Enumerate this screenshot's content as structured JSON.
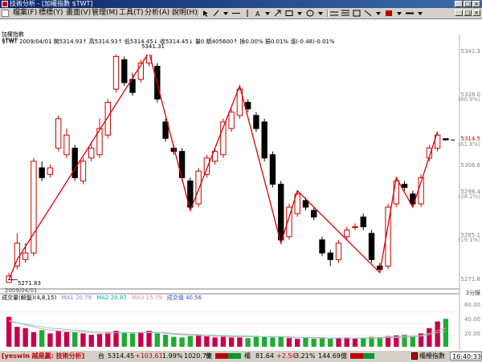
{
  "window": {
    "title": "技術分析 - [加權指數 $TWT]",
    "minimize": "_",
    "maximize": "□",
    "close": "×"
  },
  "menu": [
    {
      "label": "檔案(F)"
    },
    {
      "label": "標標(Y)"
    },
    {
      "label": "畫面(V)"
    },
    {
      "label": "管理(M)"
    },
    {
      "label": "工具(T)"
    },
    {
      "label": "分析(A)"
    },
    {
      "label": "說明(H)"
    }
  ],
  "info": {
    "line1": "$TWT 2009/04/01 開5314.93↑ 高5314.93↑ 低5314.45↓ 收5314.45↓ 量0 額405600↑ 換0.00% 振0.01% 漲(-0.48)-0.01%",
    "panel_title": "加權指數",
    "panel_sub": "$TWT"
  },
  "price_panel": {
    "high_marker": "5341.31",
    "low_marker": "5271.83",
    "date_label": "2009/04/01",
    "axis": [
      {
        "label": "5341.3",
        "value": 5341.3
      },
      {
        "label": "5328.0",
        "value": 5328.0
      },
      {
        "label": "(80.9%)",
        "value": 5326.6,
        "muted": true
      },
      {
        "label": "5314.5",
        "value": 5314.5,
        "accent": true
      },
      {
        "label": "(61.8%)",
        "value": 5313.0,
        "muted": true
      },
      {
        "label": "5306.6",
        "value": 5306.6
      },
      {
        "label": "5298.4",
        "value": 5298.4
      },
      {
        "label": "(38.2%)",
        "value": 5296.9,
        "muted": true
      },
      {
        "label": "5285.1",
        "value": 5285.1
      },
      {
        "label": "(19.1%)",
        "value": 5283.7,
        "muted": true
      },
      {
        "label": "5271.8",
        "value": 5271.8
      }
    ],
    "corner_label": "3分鐘"
  },
  "volume_panel": {
    "title": "成交量(解盤)(4,8,15)",
    "ma1": "MA1 20.79",
    "ma2": "MA2 20.87",
    "ma3": "MA3 15.79",
    "vol": "成交值 40.56",
    "axis": [
      "60.00",
      "40.00",
      "20.00"
    ]
  },
  "status": {
    "brand": "[yeswin 越是贏: 技術分析]",
    "tw_label": "台",
    "tw_value": "5314.45",
    "tw_change": "+103.61",
    "tw_pct": "1.99%",
    "tw_amount": "1020.79",
    "tw_unit": "億",
    "otc_label": "櫃",
    "otc_value": "81.64",
    "otc_change": "+2.54",
    "otc_pct": "3.21%",
    "otc_amount": "144.69",
    "otc_unit": "億",
    "ticker_label": "櫃檯指數",
    "time": "16:40:33"
  },
  "colors": {
    "up": "#cc0000",
    "down": "#000000",
    "zigzag": "#dd0000",
    "vol_up": "#c8004a",
    "vol_down": "#22aa33"
  },
  "chart_data": {
    "type": "candlestick",
    "ylim": [
      5270,
      5344
    ],
    "candles": [
      {
        "o": 5271,
        "c": 5273,
        "h": 5274,
        "l": 5271
      },
      {
        "o": 5276,
        "c": 5283,
        "h": 5286,
        "l": 5275
      },
      {
        "o": 5278,
        "c": 5280,
        "h": 5283,
        "l": 5277
      },
      {
        "o": 5280,
        "c": 5308,
        "h": 5309,
        "l": 5279
      },
      {
        "o": 5306,
        "c": 5303,
        "h": 5308,
        "l": 5302
      },
      {
        "o": 5304,
        "c": 5306,
        "h": 5307,
        "l": 5303
      },
      {
        "o": 5312,
        "c": 5321,
        "h": 5322,
        "l": 5311
      },
      {
        "o": 5310,
        "c": 5316,
        "h": 5318,
        "l": 5309
      },
      {
        "o": 5312,
        "c": 5303,
        "h": 5313,
        "l": 5302
      },
      {
        "o": 5302,
        "c": 5308,
        "h": 5309,
        "l": 5301
      },
      {
        "o": 5309,
        "c": 5312,
        "h": 5314,
        "l": 5308
      },
      {
        "o": 5310,
        "c": 5318,
        "h": 5321,
        "l": 5309
      },
      {
        "o": 5316,
        "c": 5326,
        "h": 5327,
        "l": 5315
      },
      {
        "o": 5330,
        "c": 5340,
        "h": 5341,
        "l": 5329
      },
      {
        "o": 5339,
        "c": 5332,
        "h": 5340,
        "l": 5331
      },
      {
        "o": 5333,
        "c": 5329,
        "h": 5335,
        "l": 5328
      },
      {
        "o": 5333,
        "c": 5338,
        "h": 5339,
        "l": 5332
      },
      {
        "o": 5338,
        "c": 5341,
        "h": 5341.3,
        "l": 5337
      },
      {
        "o": 5337,
        "c": 5327,
        "h": 5338,
        "l": 5326
      },
      {
        "o": 5320,
        "c": 5315,
        "h": 5321,
        "l": 5314
      },
      {
        "o": 5312,
        "c": 5311,
        "h": 5313,
        "l": 5310
      },
      {
        "o": 5311,
        "c": 5303,
        "h": 5312,
        "l": 5302
      },
      {
        "o": 5302,
        "c": 5294,
        "h": 5303,
        "l": 5293
      },
      {
        "o": 5295,
        "c": 5305,
        "h": 5306,
        "l": 5294
      },
      {
        "o": 5304,
        "c": 5309,
        "h": 5310,
        "l": 5303
      },
      {
        "o": 5308,
        "c": 5311,
        "h": 5312,
        "l": 5307
      },
      {
        "o": 5310,
        "c": 5320,
        "h": 5321,
        "l": 5309
      },
      {
        "o": 5318,
        "c": 5323,
        "h": 5324,
        "l": 5317
      },
      {
        "o": 5322,
        "c": 5330,
        "h": 5331,
        "l": 5321
      },
      {
        "o": 5326,
        "c": 5324,
        "h": 5327,
        "l": 5323
      },
      {
        "o": 5322,
        "c": 5318,
        "h": 5323,
        "l": 5317
      },
      {
        "o": 5320,
        "c": 5309,
        "h": 5321,
        "l": 5308
      },
      {
        "o": 5310,
        "c": 5301,
        "h": 5311,
        "l": 5300
      },
      {
        "o": 5301,
        "c": 5284,
        "h": 5302,
        "l": 5283
      },
      {
        "o": 5285,
        "c": 5294,
        "h": 5295,
        "l": 5284
      },
      {
        "o": 5292,
        "c": 5298,
        "h": 5299,
        "l": 5291
      },
      {
        "o": 5296,
        "c": 5294,
        "h": 5297,
        "l": 5293
      },
      {
        "o": 5293,
        "c": 5291,
        "h": 5294,
        "l": 5290
      },
      {
        "o": 5284,
        "c": 5280,
        "h": 5285,
        "l": 5279
      },
      {
        "o": 5280,
        "c": 5278,
        "h": 5281,
        "l": 5276
      },
      {
        "o": 5278,
        "c": 5283,
        "h": 5284,
        "l": 5277
      },
      {
        "o": 5285,
        "c": 5287,
        "h": 5288,
        "l": 5284
      },
      {
        "o": 5288,
        "c": 5288,
        "h": 5289,
        "l": 5287
      },
      {
        "o": 5291,
        "c": 5288,
        "h": 5292,
        "l": 5287
      },
      {
        "o": 5286,
        "c": 5278,
        "h": 5287,
        "l": 5277
      },
      {
        "o": 5276,
        "c": 5275,
        "h": 5277,
        "l": 5274
      },
      {
        "o": 5276,
        "c": 5294,
        "h": 5295,
        "l": 5275
      },
      {
        "o": 5295,
        "c": 5302,
        "h": 5303,
        "l": 5294
      },
      {
        "o": 5301,
        "c": 5300,
        "h": 5302,
        "l": 5299
      },
      {
        "o": 5298,
        "c": 5295,
        "h": 5299,
        "l": 5294
      },
      {
        "o": 5295,
        "c": 5303,
        "h": 5304,
        "l": 5294
      },
      {
        "o": 5309,
        "c": 5312,
        "h": 5313,
        "l": 5308
      },
      {
        "o": 5312,
        "c": 5316,
        "h": 5317,
        "l": 5311
      },
      {
        "o": 5314.9,
        "c": 5314.5,
        "h": 5314.9,
        "l": 5314.4
      }
    ],
    "zigzag": [
      {
        "i": 0,
        "v": 5271.8
      },
      {
        "i": 1,
        "v": 5278
      },
      {
        "i": 17,
        "v": 5341.3
      },
      {
        "i": 22,
        "v": 5293
      },
      {
        "i": 28,
        "v": 5331
      },
      {
        "i": 33,
        "v": 5283
      },
      {
        "i": 35,
        "v": 5299
      },
      {
        "i": 45,
        "v": 5274
      },
      {
        "i": 47,
        "v": 5303
      },
      {
        "i": 49,
        "v": 5294
      },
      {
        "i": 52,
        "v": 5317
      }
    ],
    "volume": {
      "ylim": [
        0,
        70
      ],
      "values": [
        45,
        30,
        28,
        22,
        25,
        20,
        24,
        22,
        22,
        20,
        18,
        19,
        21,
        24,
        22,
        20,
        22,
        24,
        20,
        18,
        15,
        14,
        16,
        18,
        16,
        14,
        15,
        14,
        14,
        13,
        16,
        15,
        14,
        15,
        13,
        12,
        14,
        12,
        13,
        12,
        13,
        14,
        12,
        13,
        15,
        14,
        16,
        17,
        18,
        16,
        20,
        28,
        38,
        42
      ],
      "up": [
        true,
        true,
        true,
        true,
        false,
        true,
        true,
        true,
        false,
        true,
        true,
        true,
        true,
        true,
        false,
        false,
        true,
        true,
        false,
        false,
        false,
        false,
        false,
        true,
        true,
        true,
        true,
        true,
        true,
        false,
        false,
        false,
        false,
        false,
        true,
        true,
        false,
        false,
        false,
        false,
        true,
        true,
        true,
        false,
        false,
        false,
        true,
        true,
        false,
        false,
        true,
        true,
        true,
        false
      ],
      "ma_lines": [
        [
          40,
          36,
          33,
          30,
          27,
          25,
          24,
          23,
          22,
          22,
          21,
          20,
          20,
          21,
          21,
          21,
          21,
          22,
          21,
          20,
          19,
          18,
          17,
          17,
          16,
          16,
          16,
          15,
          15,
          15,
          15,
          15,
          15,
          15,
          14,
          14,
          14,
          13,
          13,
          13,
          13,
          13,
          13,
          13,
          14,
          14,
          15,
          15,
          16,
          16,
          17,
          20,
          24,
          28
        ],
        [
          38,
          36,
          34,
          32,
          30,
          28,
          27,
          26,
          25,
          24,
          23,
          22,
          22,
          21,
          21,
          21,
          21,
          21,
          21,
          21,
          20,
          19,
          19,
          18,
          18,
          17,
          17,
          16,
          16,
          16,
          15,
          15,
          15,
          15,
          15,
          14,
          14,
          14,
          14,
          13,
          13,
          13,
          13,
          13,
          13,
          13,
          14,
          14,
          14,
          15,
          16,
          18,
          21,
          23
        ]
      ]
    }
  }
}
